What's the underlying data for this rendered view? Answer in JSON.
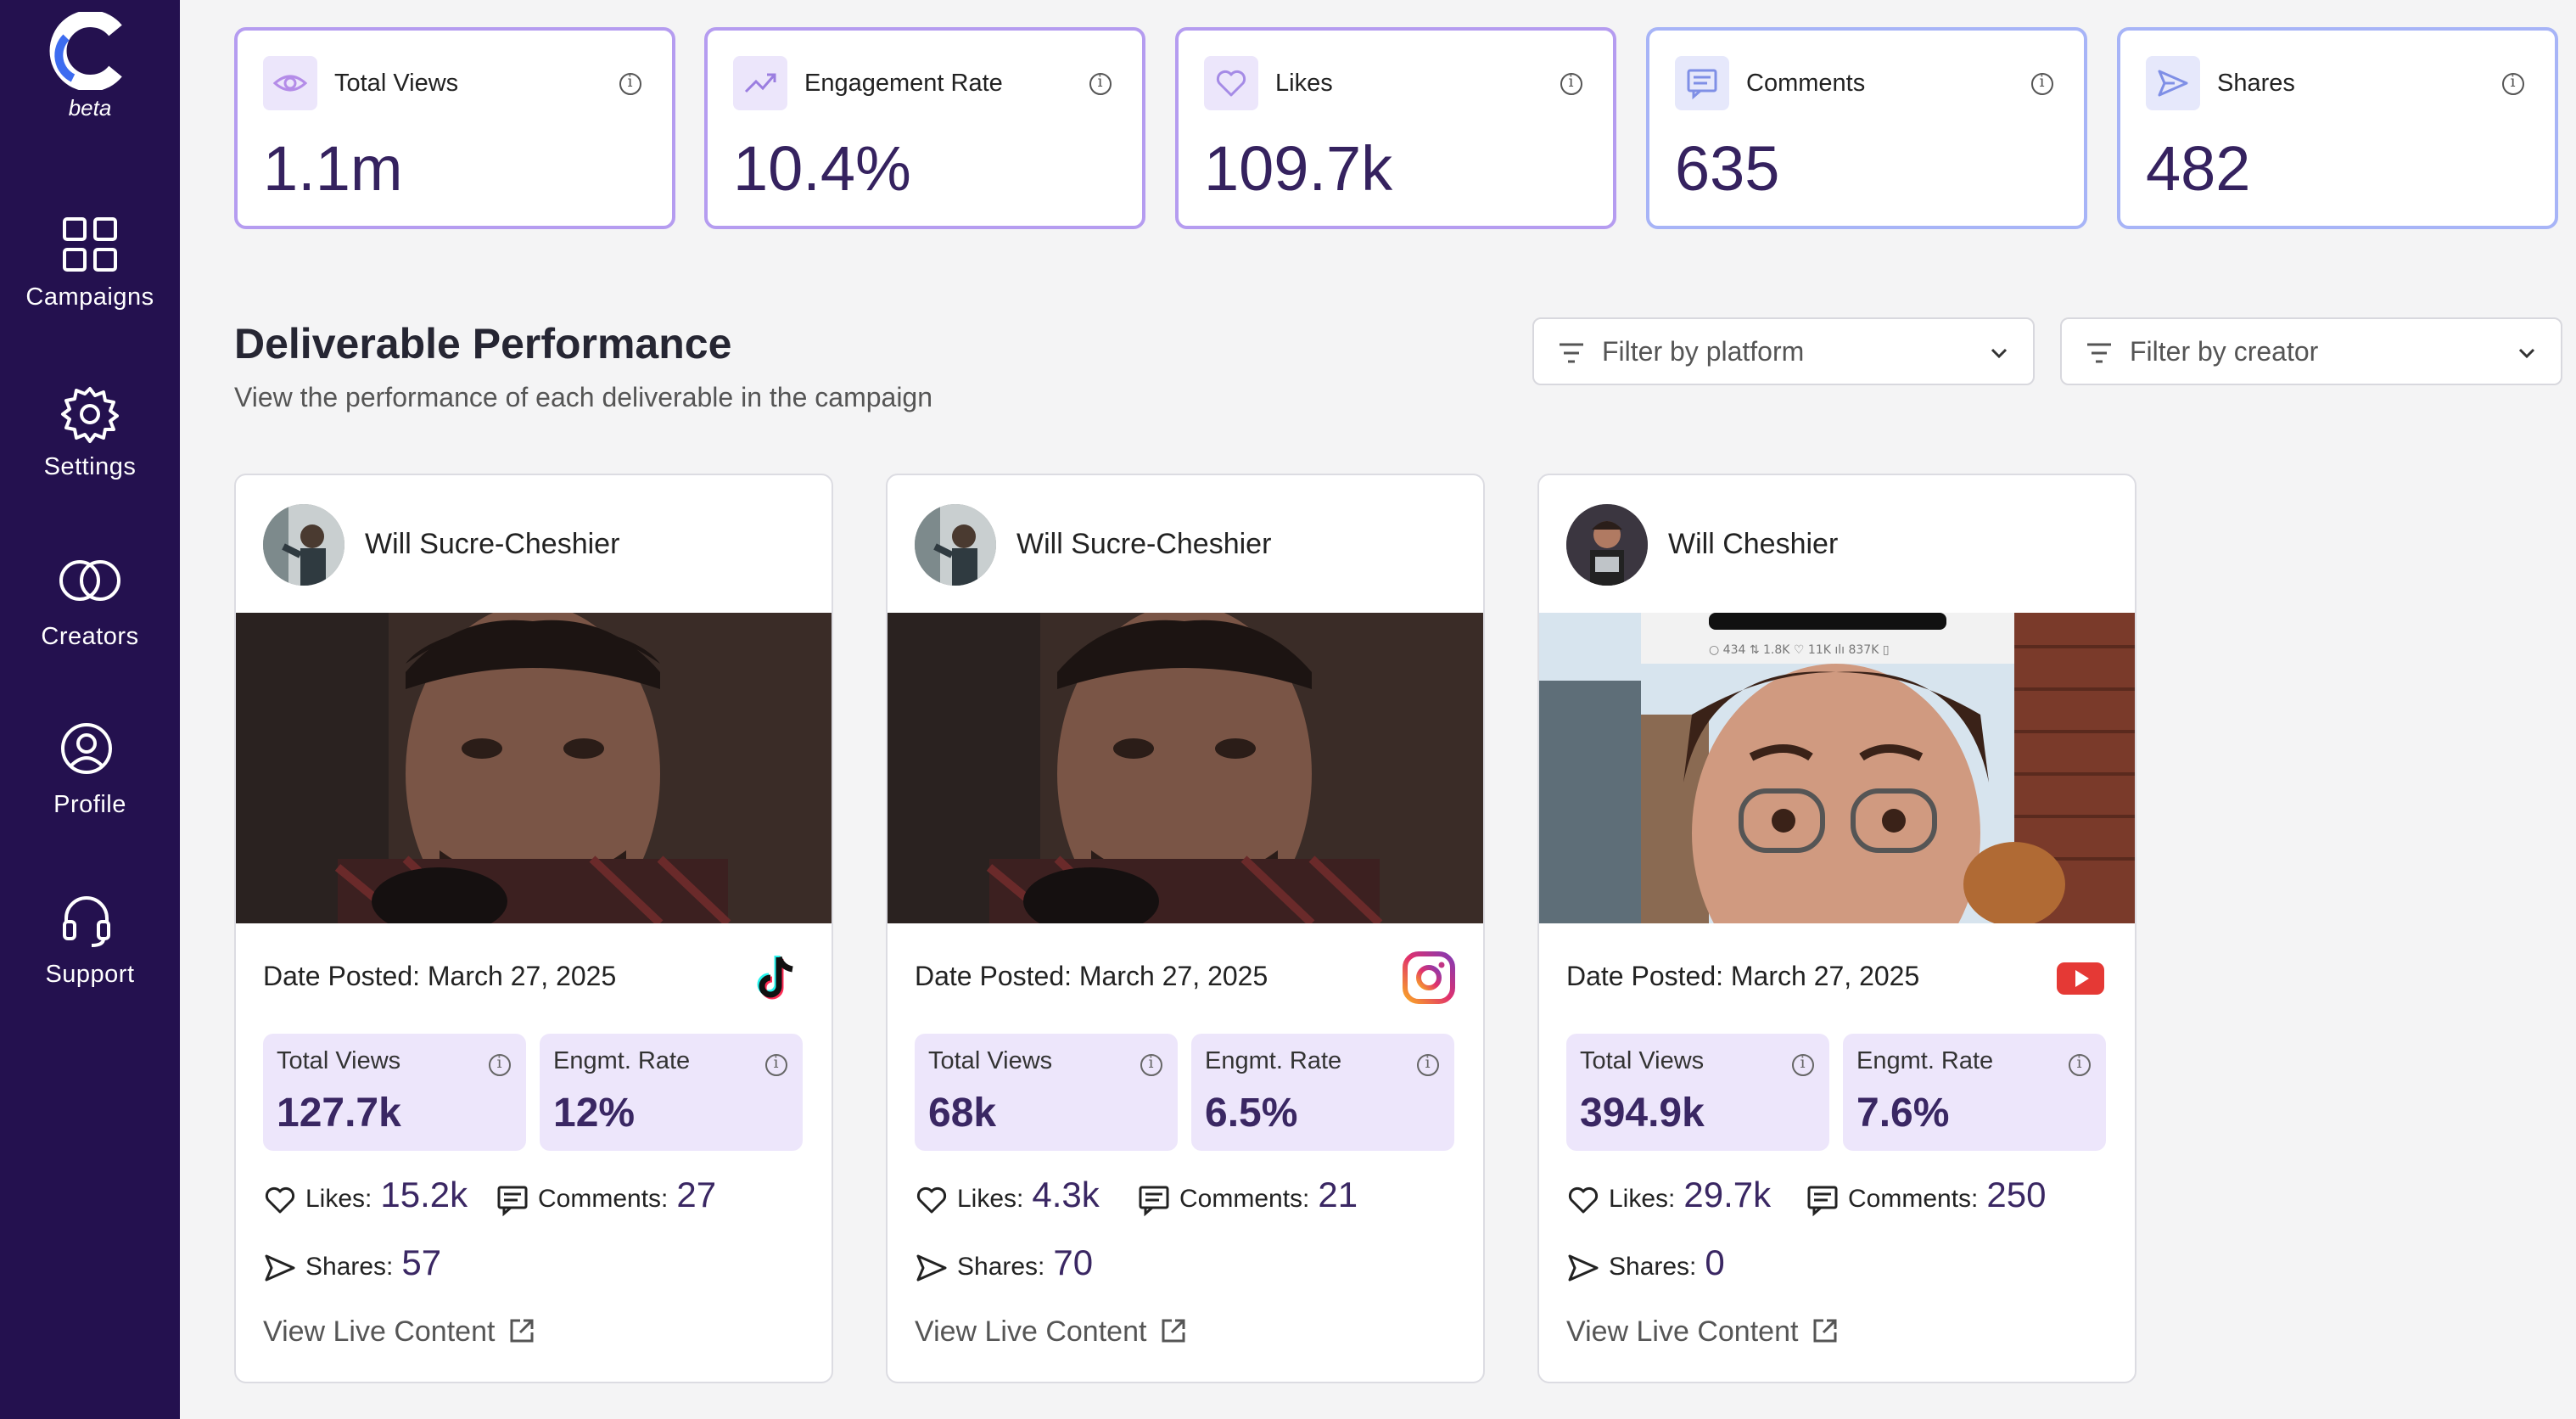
{
  "sidebar": {
    "logo_sub": "beta",
    "items": [
      {
        "label": "Campaigns",
        "icon": "grid-icon"
      },
      {
        "label": "Settings",
        "icon": "gear-icon"
      },
      {
        "label": "Creators",
        "icon": "rings-icon"
      },
      {
        "label": "Profile",
        "icon": "user-icon"
      },
      {
        "label": "Support",
        "icon": "headset-icon"
      }
    ]
  },
  "stats": [
    {
      "label": "Total Views",
      "value": "1.1m",
      "icon": "eye-icon"
    },
    {
      "label": "Engagement Rate",
      "value": "10.4%",
      "icon": "trending-up-icon"
    },
    {
      "label": "Likes",
      "value": "109.7k",
      "icon": "heart-icon"
    },
    {
      "label": "Comments",
      "value": "635",
      "icon": "comment-icon"
    },
    {
      "label": "Shares",
      "value": "482",
      "icon": "send-icon"
    }
  ],
  "section": {
    "title": "Deliverable Performance",
    "subtitle": "View the performance of each deliverable in the campaign"
  },
  "filters": {
    "platform": "Filter by platform",
    "creator": "Filter by creator"
  },
  "deliverables": [
    {
      "creator": "Will Sucre-Cheshier",
      "date": "Date Posted: March 27, 2025",
      "platform": "tiktok-icon",
      "views_label": "Total Views",
      "views": "127.7k",
      "rate_label": "Engmt. Rate",
      "rate": "12%",
      "likes_label": "Likes:",
      "likes": "15.2k",
      "comments_label": "Comments:",
      "comments": "27",
      "shares_label": "Shares:",
      "shares": "57",
      "link": "View Live Content"
    },
    {
      "creator": "Will Sucre-Cheshier",
      "date": "Date Posted: March 27, 2025",
      "platform": "instagram-icon",
      "views_label": "Total Views",
      "views": "68k",
      "rate_label": "Engmt. Rate",
      "rate": "6.5%",
      "likes_label": "Likes:",
      "likes": "4.3k",
      "comments_label": "Comments:",
      "comments": "21",
      "shares_label": "Shares:",
      "shares": "70",
      "link": "View Live Content"
    },
    {
      "creator": "Will Cheshier",
      "date": "Date Posted: March 27, 2025",
      "platform": "youtube-icon",
      "views_label": "Total Views",
      "views": "394.9k",
      "rate_label": "Engmt. Rate",
      "rate": "7.6%",
      "likes_label": "Likes:",
      "likes": "29.7k",
      "comments_label": "Comments:",
      "comments": "250",
      "shares_label": "Shares:",
      "shares": "0",
      "link": "View Live Content"
    }
  ],
  "colors": {
    "sidebar": "#24114f",
    "accent": "#35225f",
    "card_border": "#b59cf0",
    "metric_bg": "#ede6fb"
  }
}
